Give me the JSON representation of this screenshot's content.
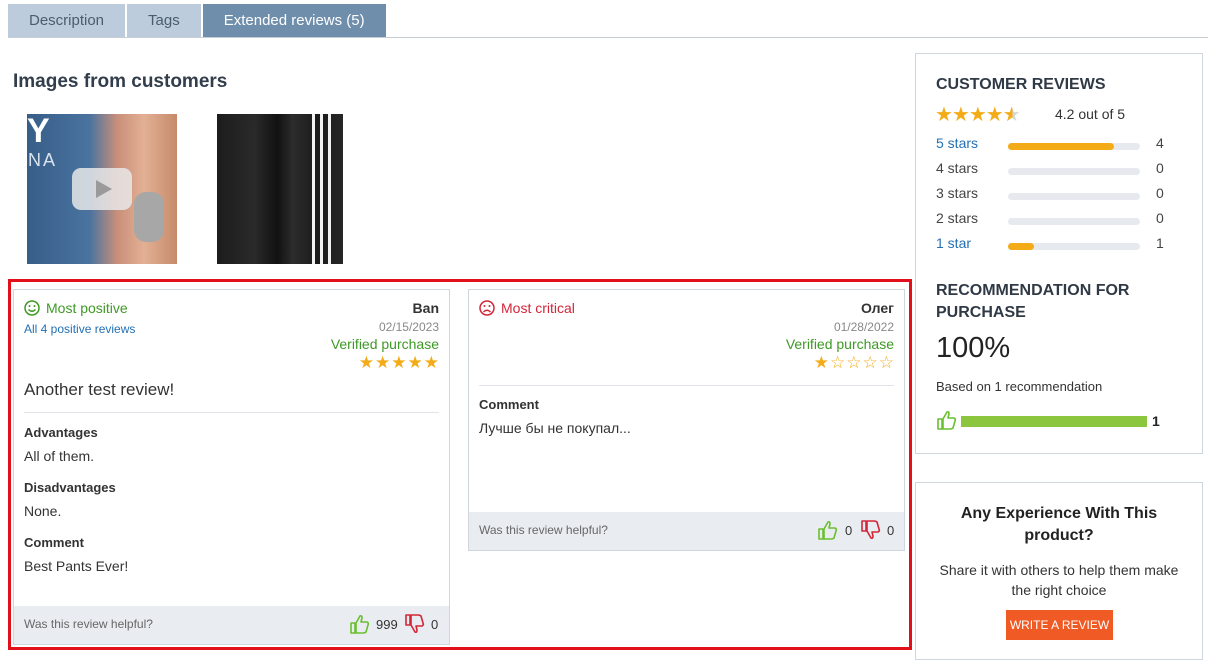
{
  "tabs": [
    "Description",
    "Tags",
    "Extended reviews (5)"
  ],
  "images_section": {
    "title": "Images from customers",
    "thumb1_text": [
      "Y",
      "NA"
    ]
  },
  "customer_reviews": {
    "title": "CUSTOMER REVIEWS",
    "average": 4.2,
    "average_text": "4.2 out of 5",
    "stars_display": "★★★★",
    "half_star": "★",
    "distribution": [
      {
        "label": "5 stars",
        "count": "4",
        "fraction": 0.8,
        "link": true
      },
      {
        "label": "4 stars",
        "count": "0",
        "fraction": 0,
        "link": false
      },
      {
        "label": "3 stars",
        "count": "0",
        "fraction": 0,
        "link": false
      },
      {
        "label": "2 stars",
        "count": "0",
        "fraction": 0,
        "link": false
      },
      {
        "label": "1 star",
        "count": "1",
        "fraction": 0.2,
        "link": true
      }
    ]
  },
  "recommendation": {
    "title": "RECOMMENDATION FOR PURCHASE",
    "percent": "100%",
    "based_on": "Based on 1 recommendation",
    "count": "1"
  },
  "experience": {
    "title": "Any Experience With This product?",
    "text": "Share it with others to help them make the right choice",
    "button": "WRITE A REVIEW"
  },
  "reviews": [
    {
      "heading": "Most positive",
      "all_link": "All 4 positive reviews",
      "author": "Ban",
      "date": "02/15/2023",
      "verified": "Verified purchase",
      "stars": "★★★★★",
      "title": "Another test review!",
      "advantages_label": "Advantages",
      "advantages": "All of them.",
      "disadvantages_label": "Disadvantages",
      "disadvantages": "None.",
      "comment_label": "Comment",
      "comment": "Best Pants Ever!",
      "helpful_question": "Was this review helpful?",
      "likes": "999",
      "dislikes": "0"
    },
    {
      "heading": "Most critical",
      "author": "Олег",
      "date": "01/28/2022",
      "verified": "Verified purchase",
      "stars": "★☆☆☆☆",
      "comment_label": "Comment",
      "comment": "Лучше бы не покупал...",
      "helpful_question": "Was this review helpful?",
      "likes": "0",
      "dislikes": "0"
    }
  ],
  "colors": {
    "accent_tab": "#6f8eab",
    "star": "#f3ac18",
    "positive": "#3d9a25",
    "negative": "#d22638",
    "button": "#f05a24",
    "highlight": "#e2101a"
  }
}
